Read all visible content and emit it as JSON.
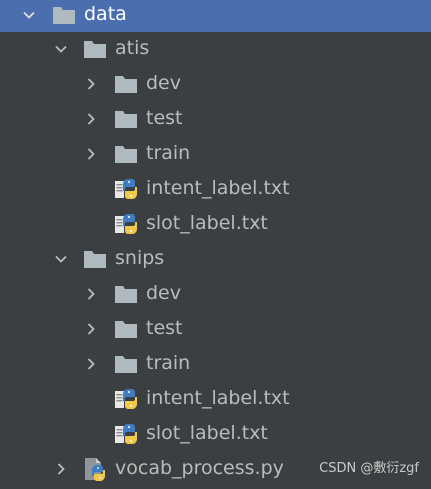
{
  "tree": {
    "root": {
      "label": "data",
      "expanded": true,
      "selected": true,
      "icon": "folder-icon"
    },
    "atis": {
      "label": "atis",
      "expanded": true,
      "icon": "folder-icon",
      "children": [
        {
          "label": "dev",
          "type": "folder",
          "expanded": false
        },
        {
          "label": "test",
          "type": "folder",
          "expanded": false
        },
        {
          "label": "train",
          "type": "folder",
          "expanded": false
        },
        {
          "label": "intent_label.txt",
          "type": "file"
        },
        {
          "label": "slot_label.txt",
          "type": "file"
        }
      ]
    },
    "snips": {
      "label": "snips",
      "expanded": true,
      "icon": "folder-icon",
      "children": [
        {
          "label": "dev",
          "type": "folder",
          "expanded": false
        },
        {
          "label": "test",
          "type": "folder",
          "expanded": false
        },
        {
          "label": "train",
          "type": "folder",
          "expanded": false
        },
        {
          "label": "intent_label.txt",
          "type": "file"
        },
        {
          "label": "slot_label.txt",
          "type": "file"
        }
      ]
    },
    "vocab": {
      "label": "vocab_process.py",
      "type": "python-file",
      "expanded": false
    }
  },
  "watermark": "CSDN @敷衍zgf",
  "colors": {
    "background": "#3c3f41",
    "selection": "#4b6eaf",
    "text": "#bbbbbb",
    "folder": "#aeb9c0"
  }
}
